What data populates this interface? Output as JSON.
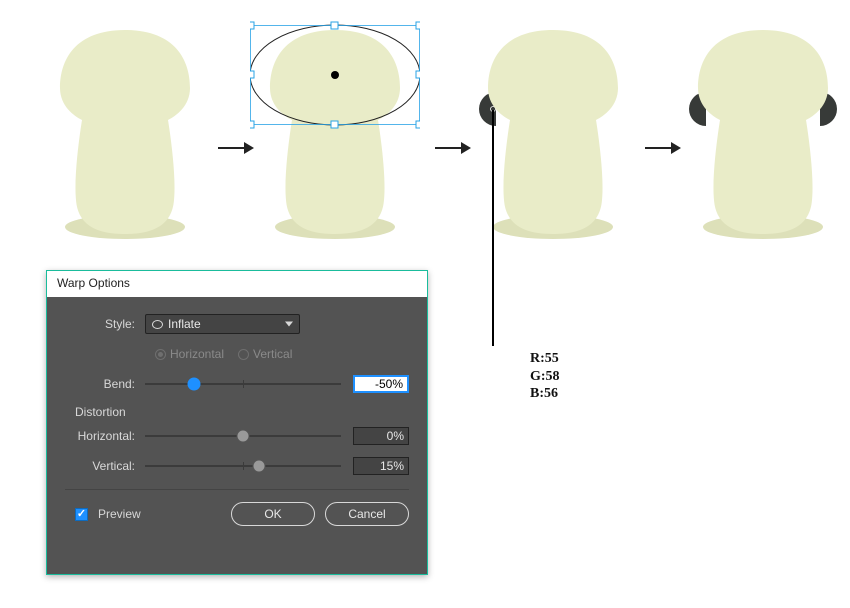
{
  "dialog": {
    "title": "Warp Options",
    "style_label": "Style:",
    "style_value": "Inflate",
    "orientation_h": "Horizontal",
    "orientation_v": "Vertical",
    "bend_label": "Bend:",
    "bend_value": "-50%",
    "bend_pct": 25,
    "distortion_label": "Distortion",
    "horizontal_label": "Horizontal:",
    "horizontal_value": "0%",
    "horizontal_pct": 50,
    "vertical_label": "Vertical:",
    "vertical_value": "15%",
    "vertical_pct": 58,
    "preview_label": "Preview",
    "ok_label": "OK",
    "cancel_label": "Cancel"
  },
  "rgb": {
    "r_label": "R:55",
    "g_label": "G:58",
    "b_label": "B:56"
  },
  "colors": {
    "shape_fill": "#e9ecc8",
    "shape_shadow": "#dde0b9",
    "ear_dark": "#373a38",
    "accent": "#1abc9c"
  }
}
